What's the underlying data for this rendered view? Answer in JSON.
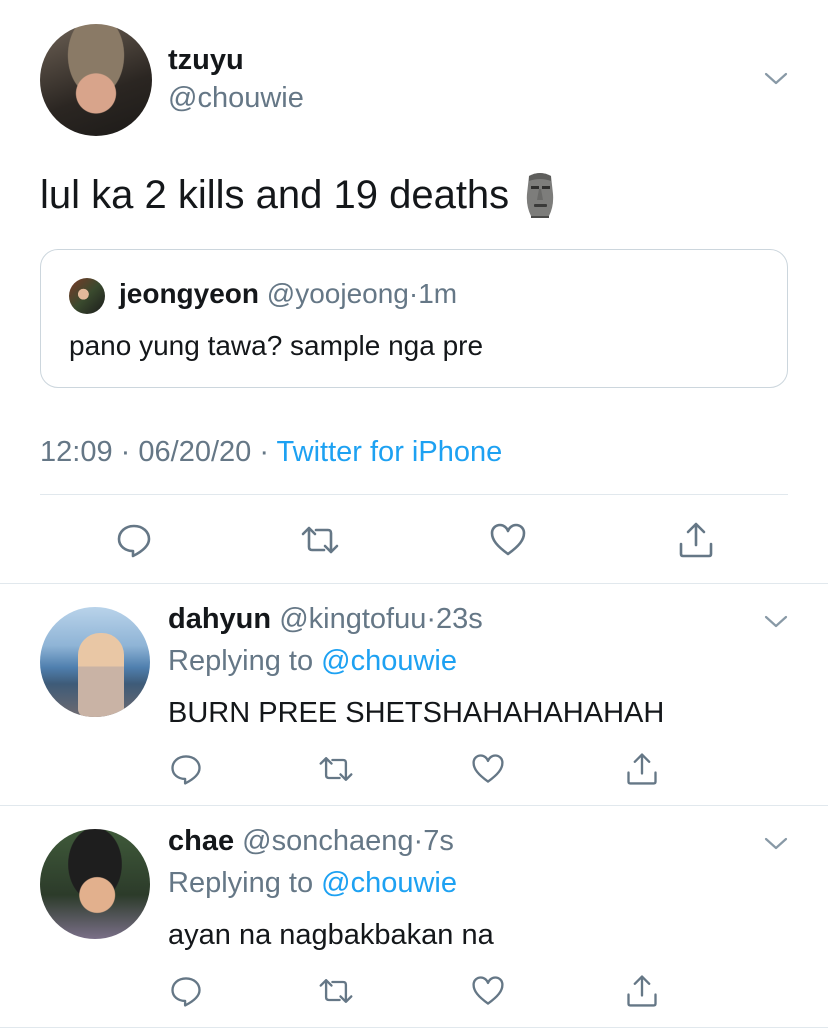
{
  "main_tweet": {
    "display_name": "tzuyu",
    "handle": "@chouwie",
    "text": "lul ka 2 kills and 19 deaths",
    "emoji_icon": "moai-icon",
    "quoted": {
      "display_name": "jeongyeon",
      "handle": "@yoojeong",
      "separator": "·",
      "time": "1m",
      "text": "pano yung tawa? sample nga pre"
    },
    "time": "12:09",
    "separator": "·",
    "date": "06/20/20",
    "source": "Twitter for iPhone",
    "actions": [
      "reply-icon",
      "retweet-icon",
      "like-icon",
      "share-icon"
    ]
  },
  "replies": [
    {
      "display_name": "dahyun",
      "handle": "@kingtofuu",
      "separator": "·",
      "time": "23s",
      "replying_prefix": "Replying to",
      "replying_to": "@chouwie",
      "text": "BURN PREE SHETSHAHAHAHAHAH"
    },
    {
      "display_name": "chae",
      "handle": "@sonchaeng",
      "separator": "·",
      "time": "7s",
      "replying_prefix": "Replying to",
      "replying_to": "@chouwie",
      "text": "ayan na nagbakbakan na"
    }
  ],
  "colors": {
    "text": "#14171a",
    "secondary": "#657786",
    "link": "#1da1f2",
    "border": "#e1e8ed",
    "icon": "#657786"
  }
}
